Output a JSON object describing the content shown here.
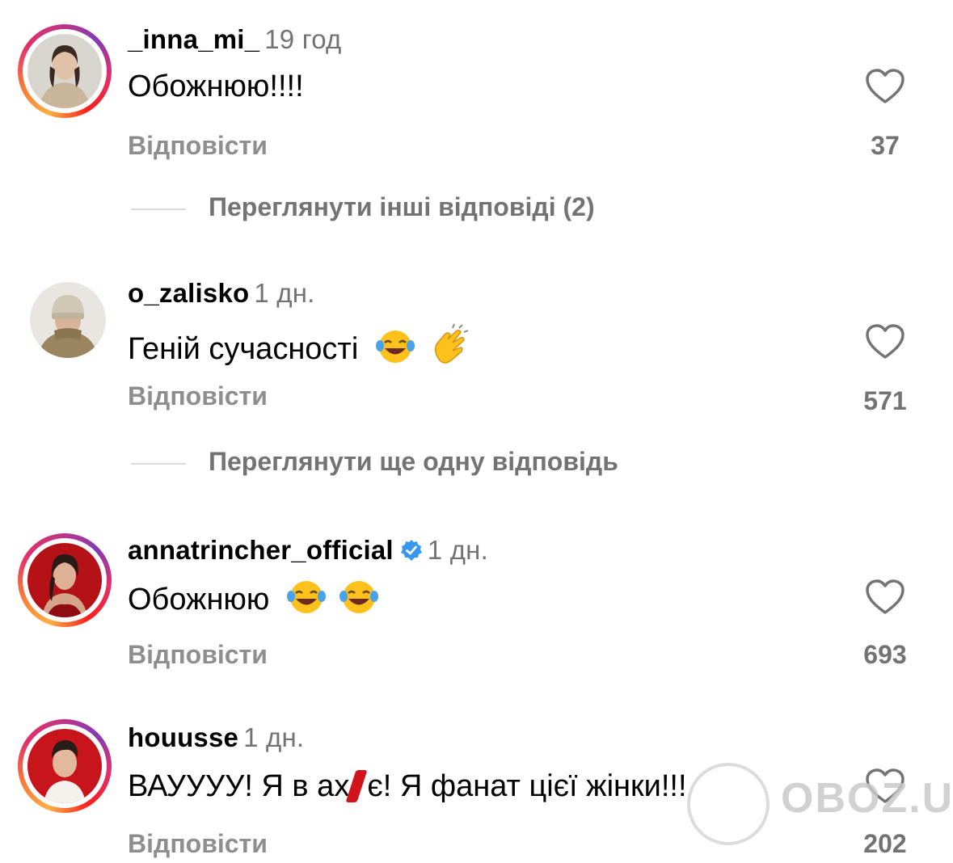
{
  "comments": [
    {
      "username": "_inna_mi_",
      "time": "19 год",
      "text": "Обожнюю!!!!",
      "reply_label": "Відповісти",
      "likes": "37",
      "view_replies": "Переглянути інші відповіді (2)",
      "avatar_icon": "avatar-woman-beige"
    },
    {
      "username": "o_zalisko",
      "time": "1 дн.",
      "text": "Геній сучасності",
      "emojis": [
        "joy-emoji",
        "clap-emoji"
      ],
      "reply_label": "Відповісти",
      "likes": "571",
      "view_replies": "Переглянути ще одну відповідь",
      "avatar_icon": "avatar-man-beanie"
    },
    {
      "username": "annatrincher_official",
      "verified": true,
      "time": "1 дн.",
      "text": "Обожнюю",
      "emojis": [
        "joy-emoji",
        "joy-emoji"
      ],
      "reply_label": "Відповісти",
      "likes": "693",
      "avatar_icon": "avatar-woman-red"
    },
    {
      "username": "houusse",
      "time": "1 дн.",
      "text_before": "ВАУУУУ! Я в ах",
      "text_after": "є! Я фанат цієї жінки!!!",
      "reply_label": "Відповісти",
      "likes": "202",
      "avatar_icon": "avatar-man-red"
    }
  ],
  "watermark": "OBOZ.UA",
  "colors": {
    "secondary_text": "#737373",
    "verified_blue": "#3897f0",
    "redaction_red": "#d0141a"
  }
}
